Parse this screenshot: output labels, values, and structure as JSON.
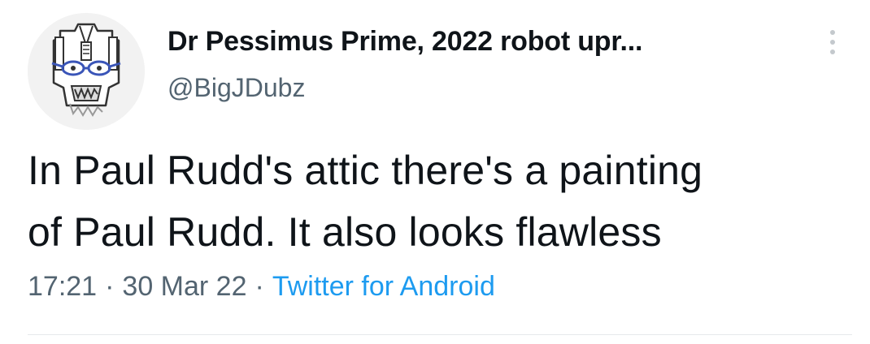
{
  "tweet": {
    "author": {
      "display_name": "Dr Pessimus Prime, 2022 robot upr...",
      "handle": "@BigJDubz",
      "avatar_icon": "robot-head-avatar"
    },
    "text_line_1": "In Paul Rudd's attic there's a painting",
    "text_line_2": "of Paul Rudd. It also looks flawless",
    "time": "17:21",
    "separator": "·",
    "date": "30 Mar 22",
    "source": "Twitter for Android",
    "more_icon": "more-vertical-icon"
  },
  "colors": {
    "primary_text": "#0f1419",
    "secondary_text": "#536471",
    "link": "#1d9bf0"
  }
}
